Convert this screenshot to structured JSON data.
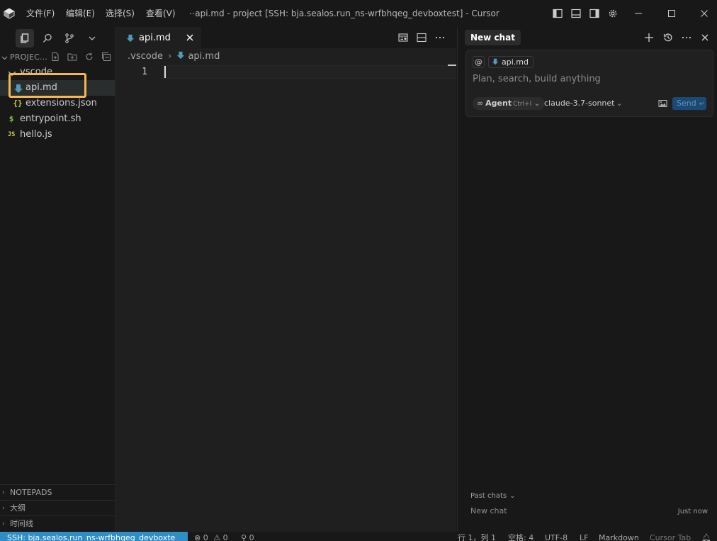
{
  "titlebar": {
    "menu": [
      "文件(F)",
      "编辑(E)",
      "选择(S)",
      "查看(V)",
      "⋯"
    ],
    "window_title": "api.md - project [SSH: bja.sealos.run_ns-wrfbhqeg_devboxtest] - Cursor"
  },
  "sidebar": {
    "explorer_title": "PROJEC...",
    "tree": [
      {
        "label": ".vscode",
        "icon": "chevron-down-icon"
      },
      {
        "label": "api.md",
        "icon": "markdown-icon",
        "selected": true
      },
      {
        "label": "extensions.json",
        "icon": "json-icon",
        "icon_text": "{}"
      },
      {
        "label": "entrypoint.sh",
        "icon": "shell-icon",
        "icon_text": "$"
      },
      {
        "label": "hello.js",
        "icon": "js-icon",
        "icon_text": "JS"
      }
    ],
    "sections": [
      "NOTEPADS",
      "大纲",
      "时间线"
    ]
  },
  "editor": {
    "tab_label": "api.md",
    "breadcrumb": {
      "folder": ".vscode",
      "file": "api.md"
    },
    "line_number": "1"
  },
  "chat": {
    "tab_label": "New chat",
    "at_symbol": "@",
    "context_file": "api.md",
    "placeholder": "Plan, search, build anything",
    "mode_label": "Agent",
    "mode_shortcut": "Ctrl+I",
    "model": "claude-3.7-sonnet",
    "send_label": "Send",
    "past_chats_label": "Past chats",
    "past_chat_title": "New chat",
    "past_chat_time": "Just now"
  },
  "statusbar": {
    "remote": "SSH: bja.sealos.run_ns-wrfbhqeg_devboxte",
    "errors": "0",
    "warnings": "0",
    "ports": "0",
    "position": "行 1，列 1",
    "indent": "空格: 4",
    "encoding": "UTF-8",
    "eol": "LF",
    "language": "Markdown",
    "cursor_tab": "Cursor Tab"
  },
  "colors": {
    "accent": "#2e8ec5",
    "highlight": "#f6b74c",
    "markdown_icon": "#519aba",
    "json_icon": "#cbcb41",
    "shell_icon": "#8dc149",
    "js_icon": "#cbcb41"
  }
}
